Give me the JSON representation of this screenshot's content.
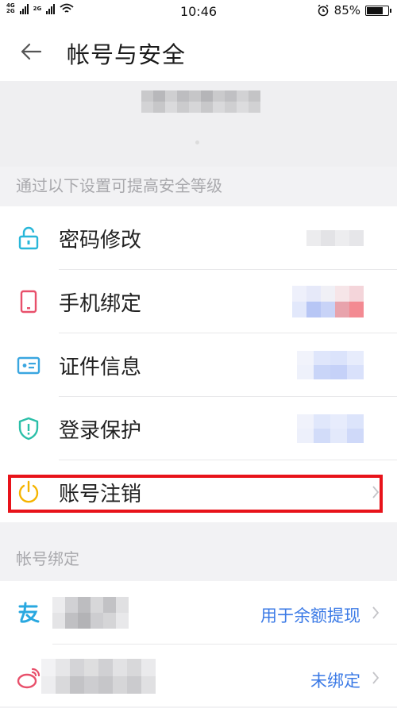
{
  "status_bar": {
    "net1": "4G",
    "net2": "2G",
    "net3": "2G",
    "time": "10:46",
    "battery": "85%",
    "battery_level": 0.85
  },
  "header": {
    "title": "帐号与安全"
  },
  "security": {
    "section_label": "通过以下设置可提高安全等级",
    "items": [
      {
        "label": "密码修改",
        "icon": "lock-icon"
      },
      {
        "label": "手机绑定",
        "icon": "phone-icon"
      },
      {
        "label": "证件信息",
        "icon": "id-card-icon"
      },
      {
        "label": "登录保护",
        "icon": "shield-alert-icon"
      },
      {
        "label": "账号注销",
        "icon": "power-icon"
      }
    ]
  },
  "binding": {
    "section_label": "帐号绑定",
    "items": [
      {
        "icon": "alipay-icon",
        "right_text": "用于余额提现"
      },
      {
        "icon": "weibo-icon",
        "right_text": "未绑定"
      }
    ]
  },
  "colors": {
    "accent_blue": "#3b7ae6",
    "lock": "#29b7d9",
    "phone": "#e8506b",
    "id": "#3aa6e0",
    "shield": "#2bbfa8",
    "power": "#f5b400",
    "highlight": "#e8131a"
  }
}
